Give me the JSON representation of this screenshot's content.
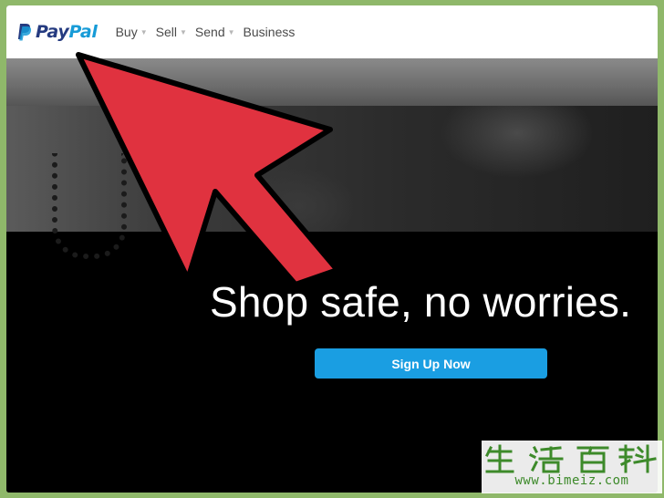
{
  "nav": {
    "brand": {
      "pay": "Pay",
      "pal": "Pal"
    },
    "items": [
      {
        "label": "Buy",
        "has_caret": true
      },
      {
        "label": "Sell",
        "has_caret": true
      },
      {
        "label": "Send",
        "has_caret": true
      },
      {
        "label": "Business",
        "has_caret": false
      }
    ],
    "caret_glyph": "▼"
  },
  "hero": {
    "headline": "Shop safe, no worries.",
    "cta_label": "Sign Up Now"
  },
  "overlay": {
    "arrow_color": "#e0323f",
    "arrow_outline": "#000000"
  },
  "watermark": {
    "chars": "生活百科",
    "url": "www.bimeiz.com"
  },
  "colors": {
    "paypal_dark": "#253b80",
    "paypal_light": "#179bd7",
    "cta": "#1a9ee2",
    "watermark_green": "#3d8a2a"
  }
}
